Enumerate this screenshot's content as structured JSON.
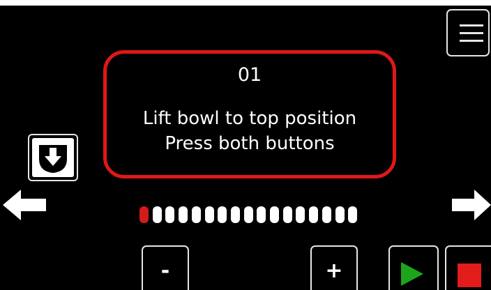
{
  "colors": {
    "background": "#000000",
    "frame": "#e6e6e6",
    "alert_border": "#e01818",
    "progress_active": "#d41a1a",
    "progress_inactive": "#ffffff",
    "play": "#1ca51c",
    "stop": "#e21b1b"
  },
  "icons": {
    "menu": "hamburger-icon",
    "bowl_down": "bowl-down-icon",
    "left": "arrow-left-icon",
    "right": "arrow-right-icon",
    "play": "play-icon",
    "stop": "stop-icon"
  },
  "message": {
    "step_number": "01",
    "line1": "Lift bowl to top position",
    "line2": "Press both buttons"
  },
  "progress": {
    "total_steps": 17,
    "current_step": 1
  },
  "controls": {
    "minus_label": "-",
    "plus_label": "+"
  }
}
